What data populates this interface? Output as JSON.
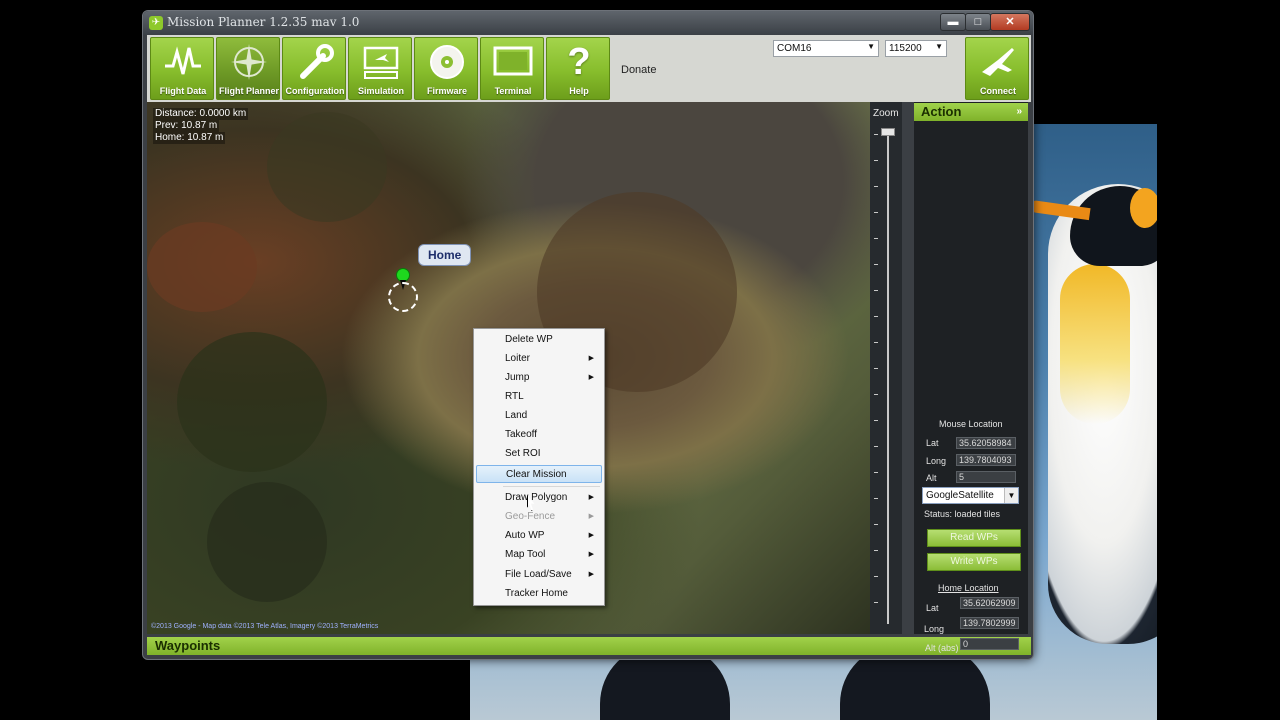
{
  "window": {
    "title": "Mission Planner 1.2.35 mav 1.0",
    "minimize": "▬",
    "maximize": "□",
    "close": "✕"
  },
  "toolbar": {
    "items": [
      {
        "label": "Flight Data",
        "icon": "pulse-icon"
      },
      {
        "label": "Flight Planner",
        "icon": "compass-icon"
      },
      {
        "label": "Configuration",
        "icon": "wrench-icon"
      },
      {
        "label": "Simulation",
        "icon": "monitor-plane-icon"
      },
      {
        "label": "Firmware",
        "icon": "disc-icon"
      },
      {
        "label": "Terminal",
        "icon": "terminal-icon"
      },
      {
        "label": "Help",
        "icon": "question-icon"
      }
    ],
    "donate": "Donate",
    "port": "COM16",
    "baud": "115200",
    "connect": "Connect"
  },
  "map": {
    "distance": "Distance: 0.0000 km",
    "prev": "Prev: 10.87 m",
    "home": "Home: 10.87 m",
    "home_label": "Home",
    "copyright": "©2013 Google - Map data ©2013 Tele Atlas, Imagery ©2013 TerraMetrics"
  },
  "context_menu": {
    "items": [
      {
        "label": "Delete WP",
        "submenu": false
      },
      {
        "label": "Loiter",
        "submenu": true
      },
      {
        "label": "Jump",
        "submenu": true
      },
      {
        "label": "RTL",
        "submenu": false
      },
      {
        "label": "Land",
        "submenu": false
      },
      {
        "label": "Takeoff",
        "submenu": false
      },
      {
        "label": "Set ROI",
        "submenu": false
      },
      {
        "label": "Clear Mission",
        "submenu": false,
        "highlighted": true
      },
      {
        "label": "Draw Polygon",
        "submenu": true
      },
      {
        "label": "Geo-Fence",
        "submenu": true,
        "disabled": true
      },
      {
        "label": "Auto WP",
        "submenu": true
      },
      {
        "label": "Map Tool",
        "submenu": true
      },
      {
        "label": "File Load/Save",
        "submenu": true
      },
      {
        "label": "Tracker Home",
        "submenu": false
      }
    ],
    "arrow": "▶"
  },
  "zoom": {
    "label": "Zoom"
  },
  "action_panel": {
    "header": "Action",
    "collapse": "»",
    "mouse_location": "Mouse Location",
    "lat_label": "Lat",
    "lat_value": "35.62058984",
    "long_label": "Long",
    "long_value": "139.7804093",
    "alt_label": "Alt",
    "alt_value": "5",
    "map_type": "GoogleSatellite",
    "status": "Status: loaded tiles",
    "read_wps": "Read WPs",
    "write_wps": "Write WPs",
    "home_location": "Home Location",
    "home_lat_label": "Lat",
    "home_lat_value": "35.62062909",
    "home_long_label": "Long",
    "home_long_value": "139.7802999",
    "home_alt_label": "Alt (abs)",
    "home_alt_value": "0"
  },
  "waypoints": {
    "label": "Waypoints",
    "expand": "»"
  }
}
